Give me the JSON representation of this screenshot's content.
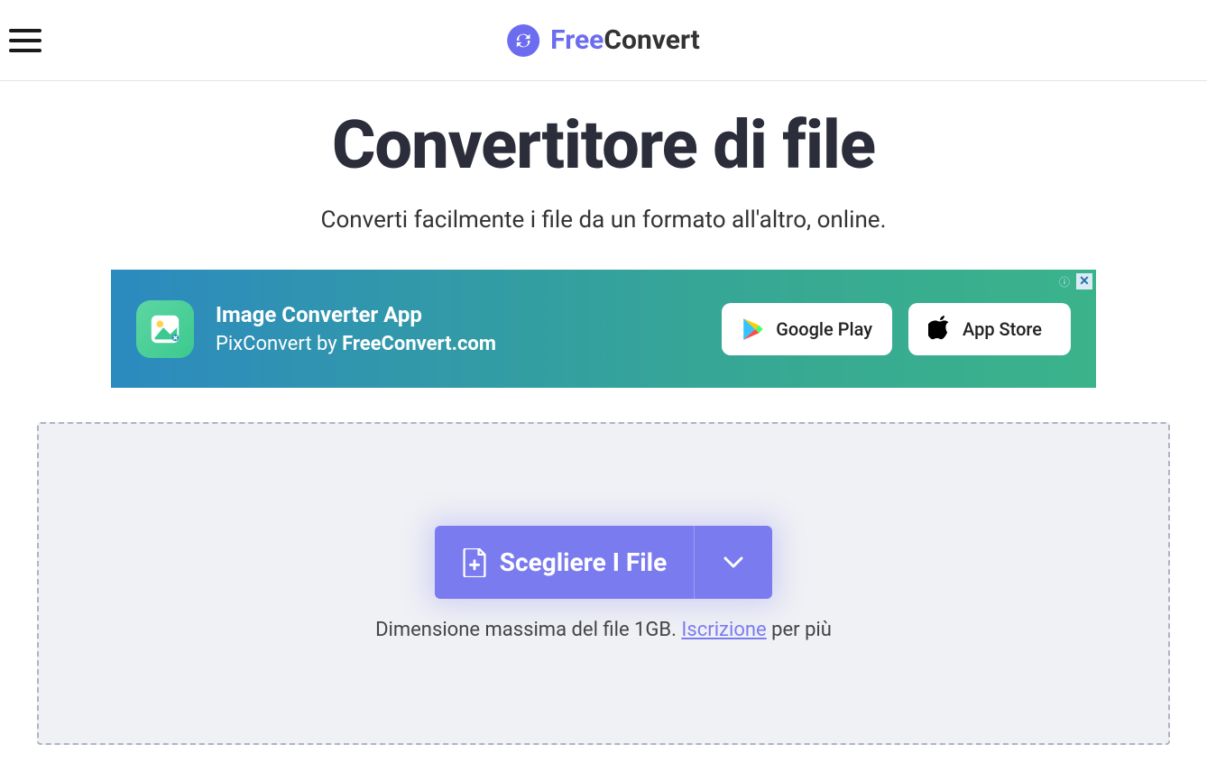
{
  "header": {
    "logo_free": "Free",
    "logo_convert": "Convert"
  },
  "main": {
    "title": "Convertitore di file",
    "subtitle": "Converti facilmente i file da un formato all'altro, online."
  },
  "ad": {
    "title": "Image Converter App",
    "subtitle_prefix": "PixConvert by ",
    "subtitle_bold": "FreeConvert.com",
    "google_play": "Google Play",
    "app_store": "App Store"
  },
  "dropzone": {
    "choose_label": "Scegliere I File",
    "note_prefix": "Dimensione massima del file 1GB. ",
    "signup_link": "Iscrizione",
    "note_suffix": " per più"
  }
}
